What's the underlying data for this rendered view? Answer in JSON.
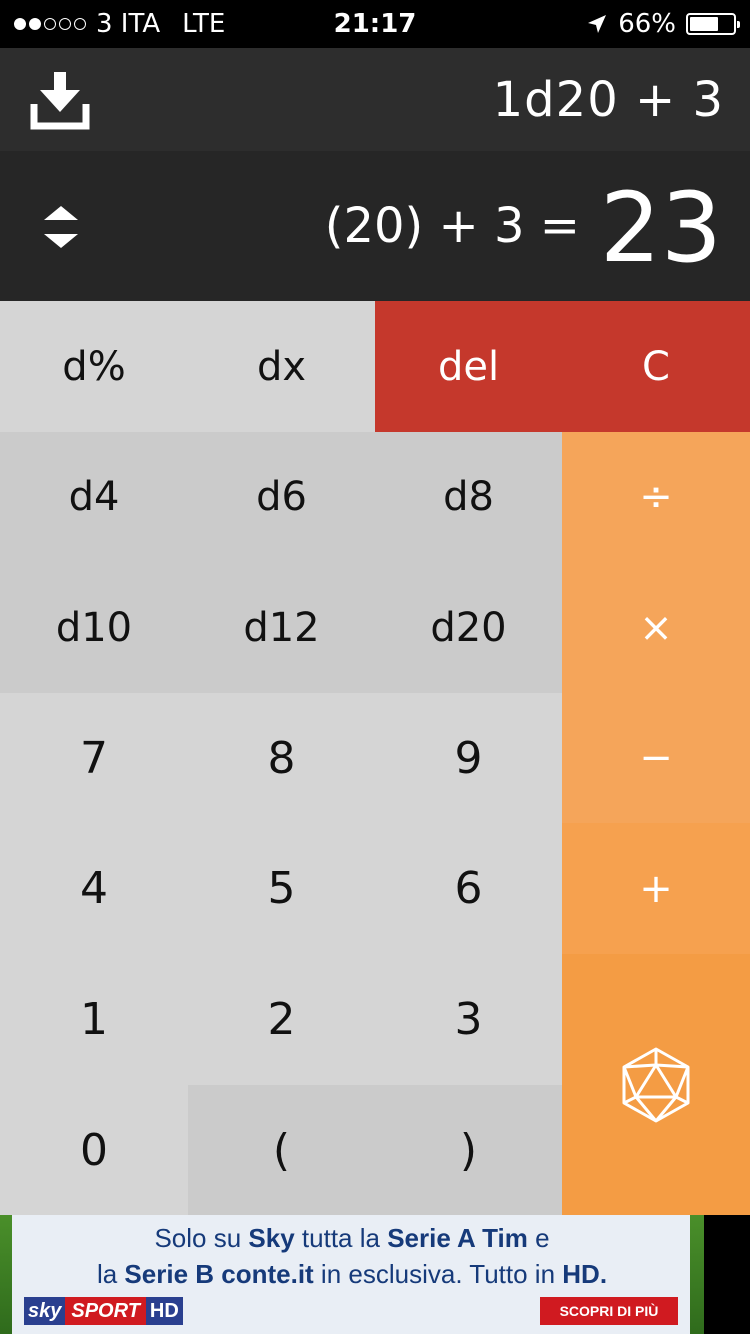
{
  "status_bar": {
    "carrier": "3 ITA",
    "network": "LTE",
    "time": "21:17",
    "battery": "66%",
    "battery_level": 0.66,
    "signal_bars_filled": 2,
    "signal_bars_total": 5
  },
  "display": {
    "expression": "1d20 + 3",
    "breakdown": "(20) + 3 =",
    "total": "23",
    "save_icon": "download-icon",
    "swap_icon": "swap-icon"
  },
  "keypad": {
    "d_percent": "d%",
    "dx": "dx",
    "del": "del",
    "clear": "C",
    "d4": "d4",
    "d6": "d6",
    "d8": "d8",
    "d10": "d10",
    "d12": "d12",
    "d20": "d20",
    "divide": "÷",
    "multiply": "×",
    "minus": "−",
    "plus": "+",
    "n7": "7",
    "n8": "8",
    "n9": "9",
    "n4": "4",
    "n5": "5",
    "n6": "6",
    "n1": "1",
    "n2": "2",
    "n3": "3",
    "n0": "0",
    "open_paren": "(",
    "close_paren": ")",
    "roll_icon": "d20-dice-icon"
  },
  "colors": {
    "red": "#c5382c",
    "orange": "#f6a14f",
    "key_light": "#d5d5d5",
    "key_mid": "#cbcbcb",
    "display_dark": "#2d2d2d"
  },
  "ad": {
    "line1_a": "Solo su ",
    "line1_b": "Sky",
    "line1_c": " tutta la ",
    "line1_d": "Serie A Tim",
    "line1_e": " e",
    "line2_a": "la ",
    "line2_b": "Serie B conte.it",
    "line2_c": " in esclusiva. Tutto  in ",
    "line2_d": "HD.",
    "logo_sky": "sky",
    "logo_sport": "SPORT",
    "logo_hd": "HD",
    "cta": "SCOPRI DI PIÙ"
  }
}
